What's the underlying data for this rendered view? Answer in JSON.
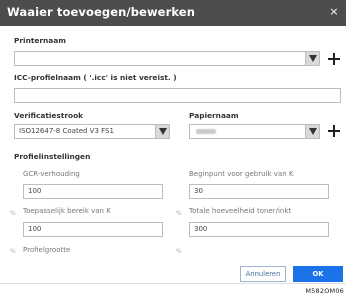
{
  "dialog": {
    "title": "Waaier toevoegen/bewerken",
    "close_glyph": "×"
  },
  "printer_name": {
    "label": "Printernaam",
    "value": ""
  },
  "icc_profile": {
    "label": "ICC-profielnaam ( '.icc' is niet vereist. )",
    "value": ""
  },
  "verification_strip": {
    "label": "Verificatiestrook",
    "value": "ISO12647-8 Coated V3 FS1"
  },
  "paper_name": {
    "label": "Papiernaam",
    "value": ""
  },
  "profile_settings": {
    "heading": "Profielinstellingen",
    "gcr": {
      "label": "GCR-verhouding",
      "value": "100"
    },
    "k_start": {
      "label": "Beginpunt voor gebruik van K",
      "value": "30"
    },
    "k_range": {
      "label": "Toepasselijk bereik van K",
      "value": "100"
    },
    "total_toner": {
      "label": "Totale hoeveelheid toner/inkt",
      "value": "300"
    },
    "profile_size": {
      "label": "Profielgrootte"
    },
    "percent_sign": "%"
  },
  "buttons": {
    "cancel": "Annuleren",
    "ok": "OK"
  },
  "figure_code": "M582OM06",
  "icons": [
    "close-icon",
    "dropdown-arrow-icon",
    "plus-icon"
  ],
  "colors": {
    "titlebar": "#4d4d4d",
    "ok_button": "#1a73e8",
    "cancel_text": "#4a6fa0"
  }
}
